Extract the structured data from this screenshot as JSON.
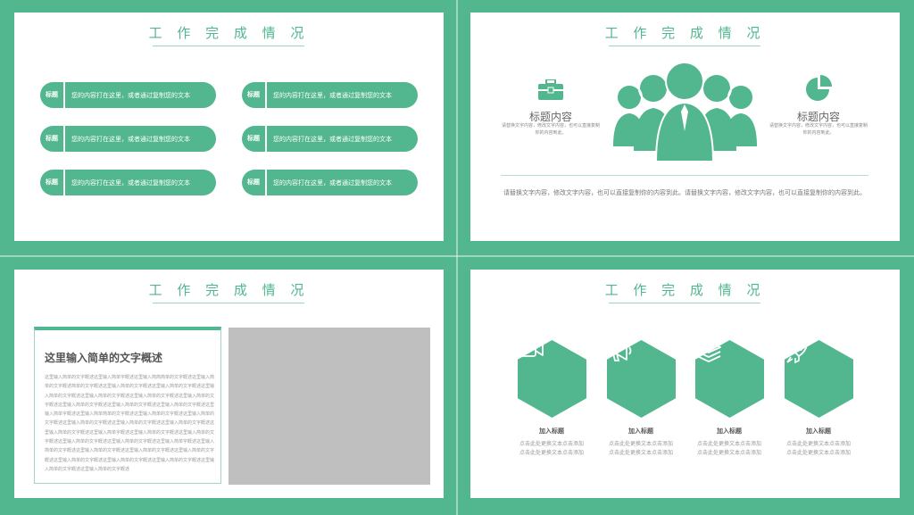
{
  "slide_title": "工 作 完 成 情 况",
  "panel1": {
    "pills": [
      {
        "tag": "标题",
        "text": "您的内容打在这里，或者通过复制您的文本"
      },
      {
        "tag": "标题",
        "text": "您的内容打在这里，或者通过复制您的文本"
      },
      {
        "tag": "标题",
        "text": "您的内容打在这里，或者通过复制您的文本"
      },
      {
        "tag": "标题",
        "text": "您的内容打在这里，或者通过复制您的文本"
      },
      {
        "tag": "标题",
        "text": "您的内容打在这里，或者通过复制您的文本"
      },
      {
        "tag": "标题",
        "text": "您的内容打在这里，或者通过复制您的文本"
      }
    ]
  },
  "panel2": {
    "left_heading": "标题内容",
    "left_desc": "请替换文字内容，修改文字内容，也可以直接复制你的内容到此。",
    "right_heading": "标题内容",
    "right_desc": "请替换文字内容，修改文字内容，也可以直接复制你的内容到此。",
    "body": "请替换文字内容，修改文字内容，也可以直接复制你的内容到此。请替换文字内容，修改文字内容，也可以直接复制你的内容到此。",
    "icon_left": "briefcase-icon",
    "icon_right": "pie-chart-icon",
    "icon_center": "team-people-icon",
    "accent": "#52b68e"
  },
  "panel3": {
    "card_title": "这里输入简单的文字概述",
    "card_body": "这里输入简单的文字概述这里输入简单字概述这里输入简简简单的文字概述这里输入简单的文字概述简单的文字概述这里输入简单的文字概述这里输入简单的文字概述这里输入简单的文字概述这里输入简单的文字概述这里输入简单的文字概述这里输入简单的文字概述这里输入简单的文字概述这里输入简单的文字概述这里输入简单的文字概述这里输入简单字概述这里输入简单简单的文字概述这里输入简单的文字概述这里输入简单的文字概述这里输入简单的文字概述这里输入简单的文字概述这里输入简单的文字概述这里输入简单的文字概述这里输入简单字概述这里输入简单的文字概述这里输入简单的文字概述这里输入简单的文字概述这里输入简单的文字概述这里输入简单字概述这里输入简单的文字概述这里输入简单的文字概述这里输入简单的文字概述这里输入简单的文字概述这里输入简单的文字概述这里输入简单的文字概述这里输入简单的文字概述这里输入简单的文字概述这里输入简单的文字概述"
  },
  "panel4": {
    "items": [
      {
        "icon": "video-camera-icon",
        "title": "加入标题",
        "line1": "点击此处更换文本点击添加",
        "line2": "点击此处更换文本点击添加"
      },
      {
        "icon": "megaphone-icon",
        "title": "加入标题",
        "line1": "点击此处更换文本点击添加",
        "line2": "点击此处更换文本点击添加"
      },
      {
        "icon": "layers-icon",
        "title": "加入标题",
        "line1": "点击此处更换文本点击添加",
        "line2": "点击此处更换文本点击添加"
      },
      {
        "icon": "rocket-icon",
        "title": "加入标题",
        "line1": "点击此处更换文本点击添加",
        "line2": "点击此处更换文本点击添加"
      }
    ]
  }
}
